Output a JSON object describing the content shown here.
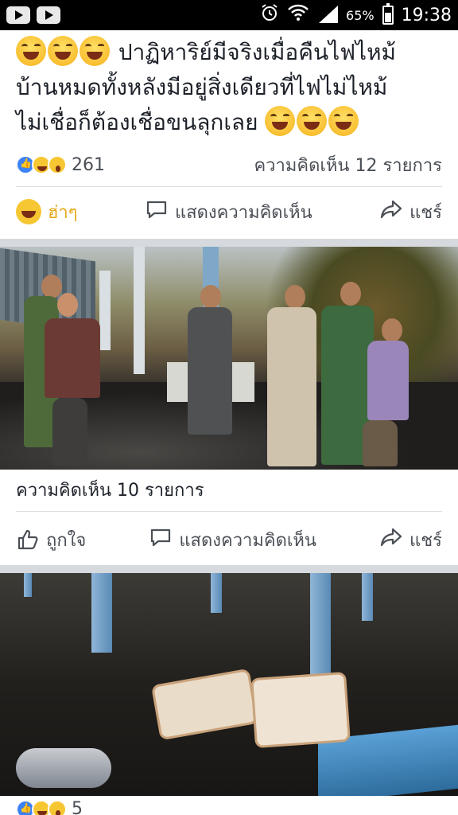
{
  "status_bar": {
    "battery_percent": "65%",
    "time": "19:38",
    "icons": [
      "youtube-icon",
      "youtube-icon",
      "alarm-icon",
      "wifi-icon",
      "signal-icon",
      "battery-icon"
    ]
  },
  "post1": {
    "text_line1": "ปาฏิหาริย์มีจริงเมื่อคืนไฟไหม้",
    "text_line2": "บ้านหมดทั้งหลังมีอยู่สิ่งเดียวที่ไฟไม่ไหม้",
    "text_line3": "ไม่เชื่อก็ต้องเชื่อขนลุกเลย",
    "reaction_count": "261",
    "comment_count": "ความคิดเห็น 12 รายการ",
    "actions": {
      "react_label": "ฮ่าๆ",
      "comment_label": "แสดงความคิดเห็น",
      "share_label": "แชร์"
    }
  },
  "post2": {
    "comment_count": "ความคิดเห็น 10 รายการ",
    "actions": {
      "like_label": "ถูกใจ",
      "comment_label": "แสดงความคิดเห็น",
      "share_label": "แชร์"
    }
  },
  "post3": {
    "reaction_count": "5"
  },
  "colors": {
    "accent_haha": "#e6a919",
    "separator": "#d6d9dd",
    "text": "#1d2129",
    "secondary_text": "#4b4f56"
  }
}
